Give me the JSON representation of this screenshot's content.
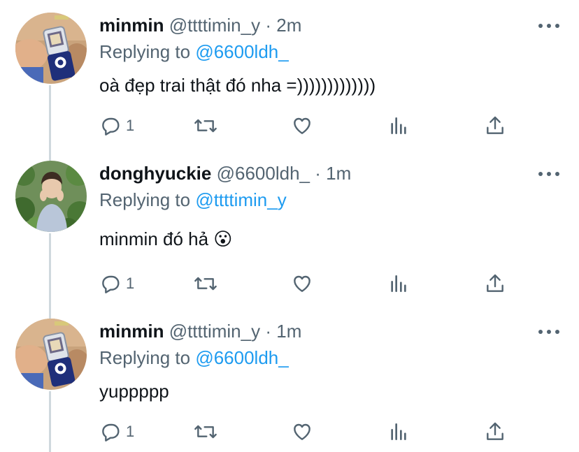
{
  "tweets": [
    {
      "name": "minmin",
      "handle": "@ttttimin_y",
      "separator": "·",
      "time": "2m",
      "reply_prefix": "Replying to",
      "reply_to": "@6600ldh_",
      "text": "oà đẹp trai thật đó nha =)))))))))))))",
      "reply_count": "1",
      "avatar_icon": "flip-phone-avatar"
    },
    {
      "name": "donghyuckie",
      "handle": "@6600ldh_",
      "separator": "·",
      "time": "1m",
      "reply_prefix": "Replying to",
      "reply_to": "@ttttimin_y",
      "text": "minmin đó hả 😮",
      "reply_count": "1",
      "avatar_icon": "person-in-plants-avatar"
    },
    {
      "name": "minmin",
      "handle": "@ttttimin_y",
      "separator": "·",
      "time": "1m",
      "reply_prefix": "Replying to",
      "reply_to": "@6600ldh_",
      "text": "yuppppp",
      "reply_count": "1",
      "avatar_icon": "flip-phone-avatar"
    }
  ],
  "colors": {
    "mention": "#1d9bf0",
    "secondary_text": "#536471",
    "primary_text": "#0f1419",
    "thread_line": "#cfd9de"
  },
  "icons": [
    "reply-icon",
    "retweet-icon",
    "like-icon",
    "analytics-icon",
    "share-icon",
    "more-icon"
  ]
}
